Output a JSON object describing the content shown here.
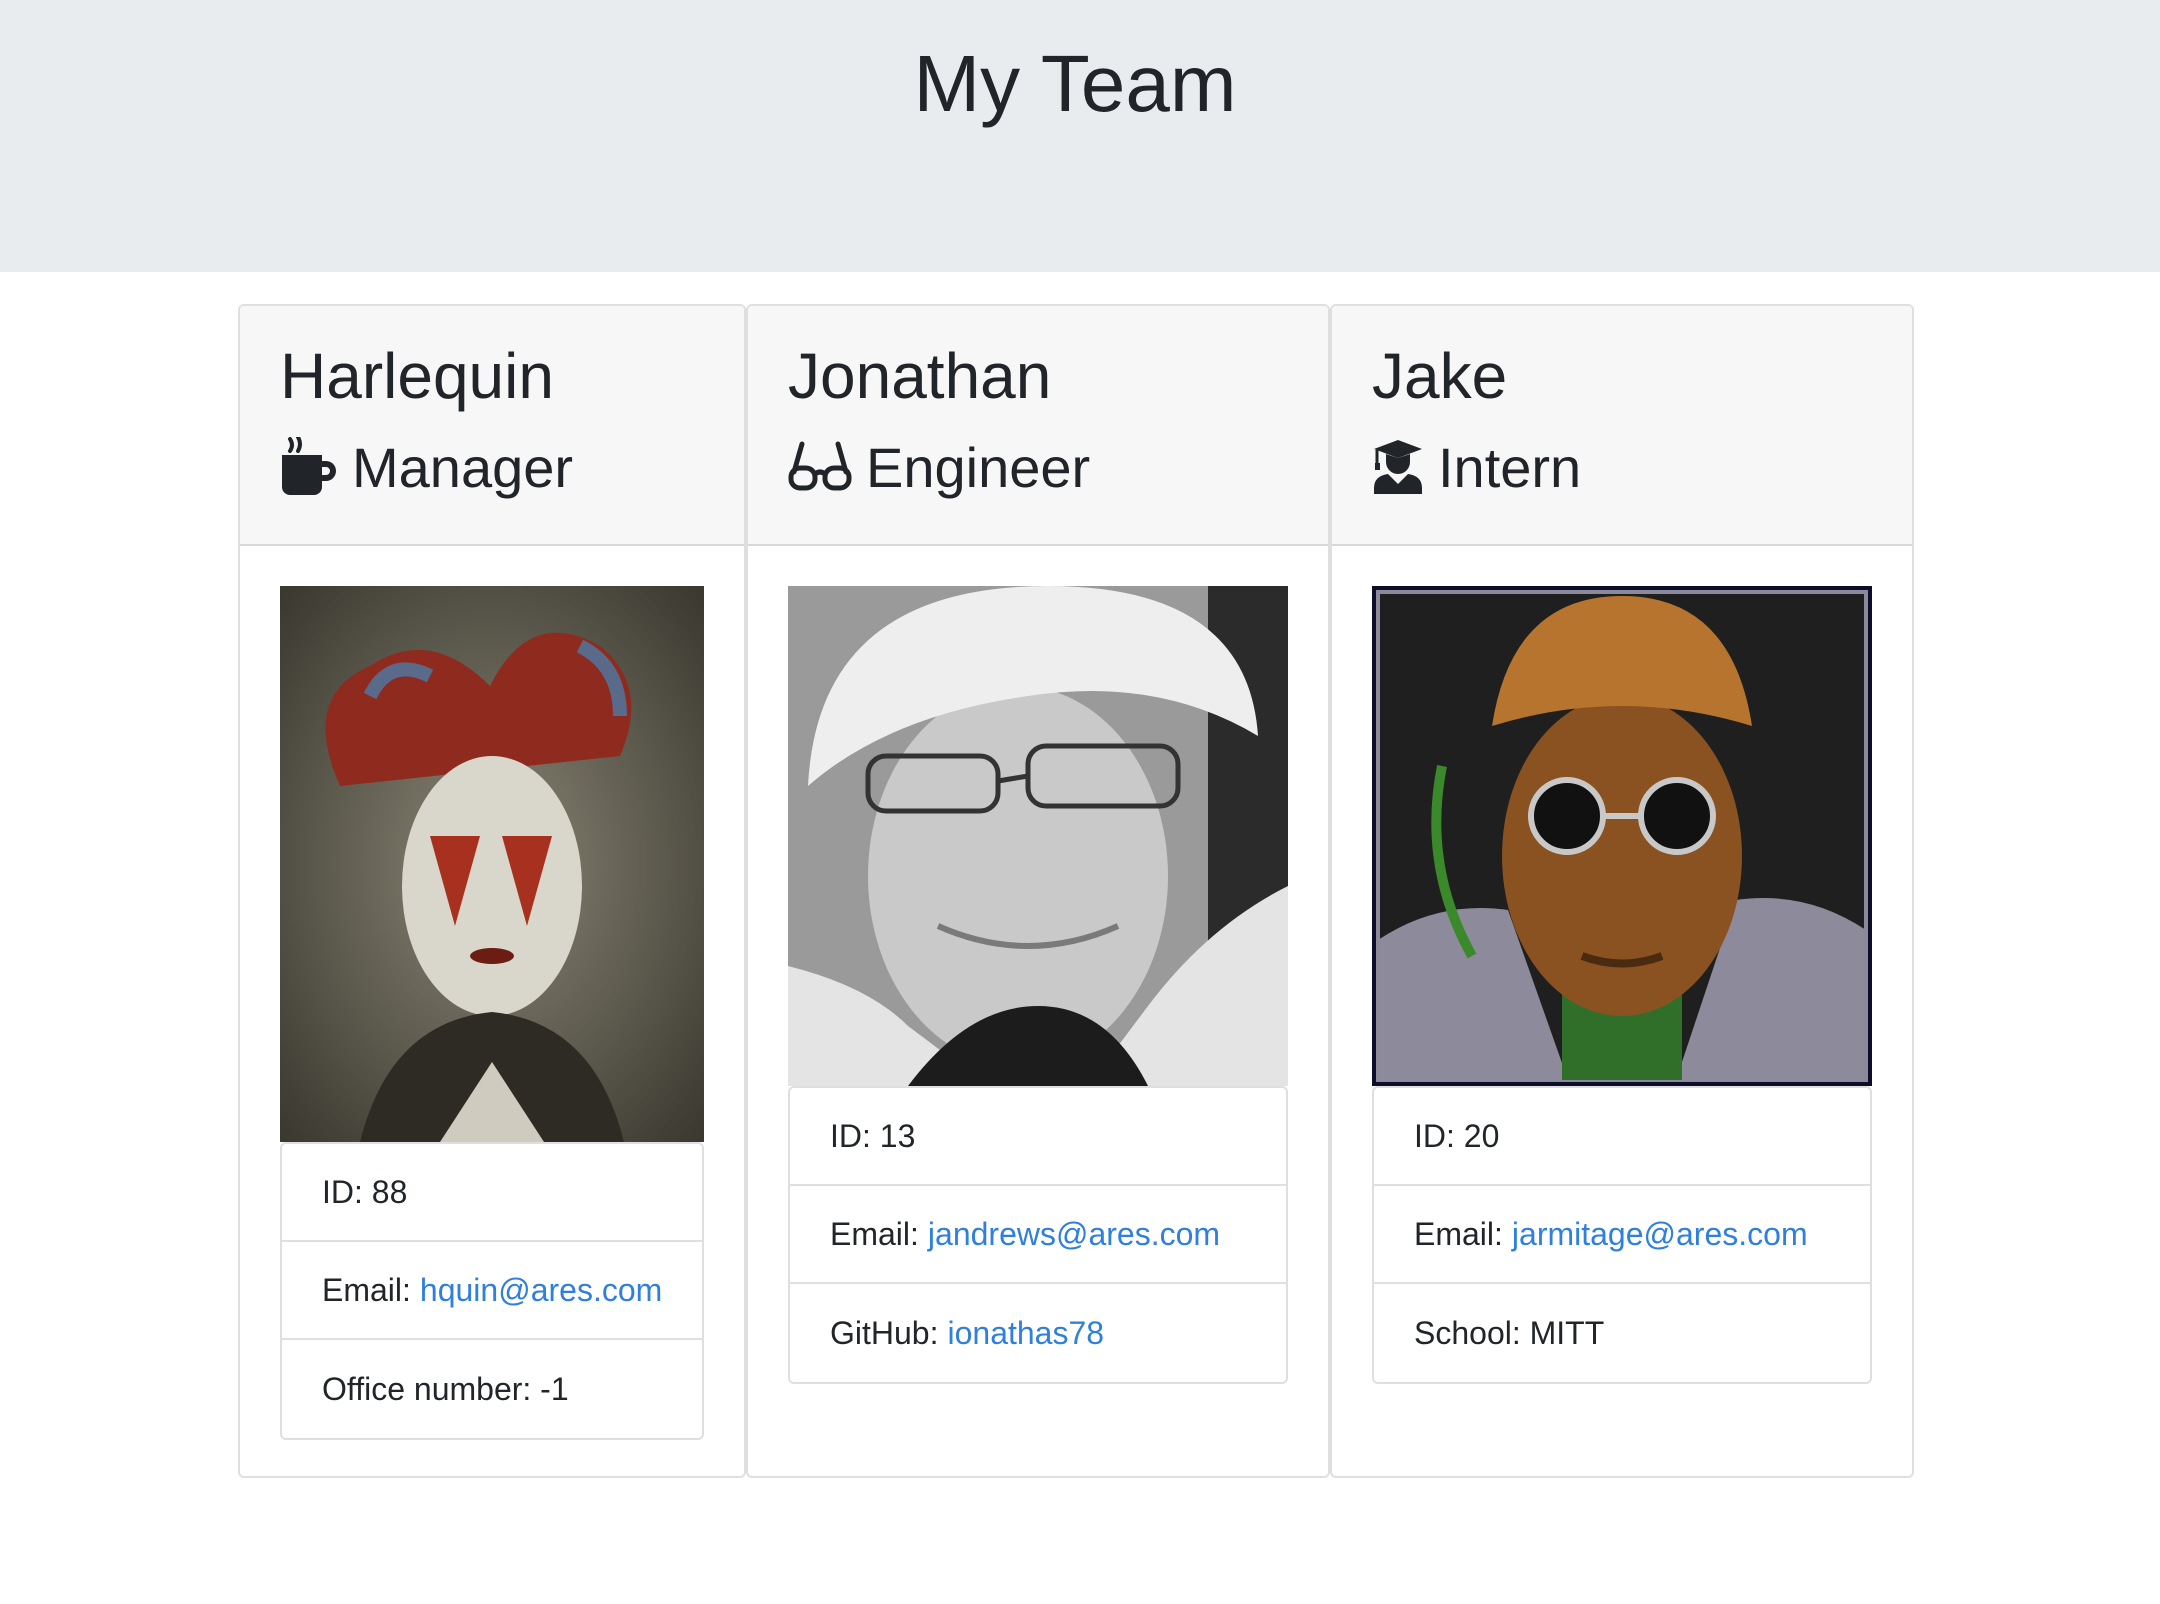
{
  "header": {
    "title": "My Team"
  },
  "cards": [
    {
      "name": "Harlequin",
      "role": "Manager",
      "role_icon": "coffee-mug-icon",
      "photo": "jester-portrait",
      "items": [
        {
          "label": "ID: 88",
          "value": ""
        },
        {
          "label": "Email:",
          "value": "hquin@ares.com"
        },
        {
          "label": "Office number: -1",
          "value": ""
        }
      ]
    },
    {
      "name": "Jonathan",
      "role": "Engineer",
      "role_icon": "glasses-icon",
      "photo": "man-with-cap-portrait",
      "items": [
        {
          "label": "ID: 13",
          "value": ""
        },
        {
          "label": "Email:",
          "value": "jandrews@ares.com"
        },
        {
          "label": "GitHub:",
          "value": "ionathas78"
        }
      ]
    },
    {
      "name": "Jake",
      "role": "Intern",
      "role_icon": "graduate-icon",
      "photo": "pixel-art-portrait",
      "items": [
        {
          "label": "ID: 20",
          "value": ""
        },
        {
          "label": "Email:",
          "value": "jarmitage@ares.com"
        },
        {
          "label": "School: MITT",
          "value": ""
        }
      ]
    }
  ],
  "colors": {
    "jumbotron_bg": "#e9ecef",
    "card_header_bg": "#f7f7f7",
    "link": "#2f7fdf",
    "text": "#212529"
  }
}
